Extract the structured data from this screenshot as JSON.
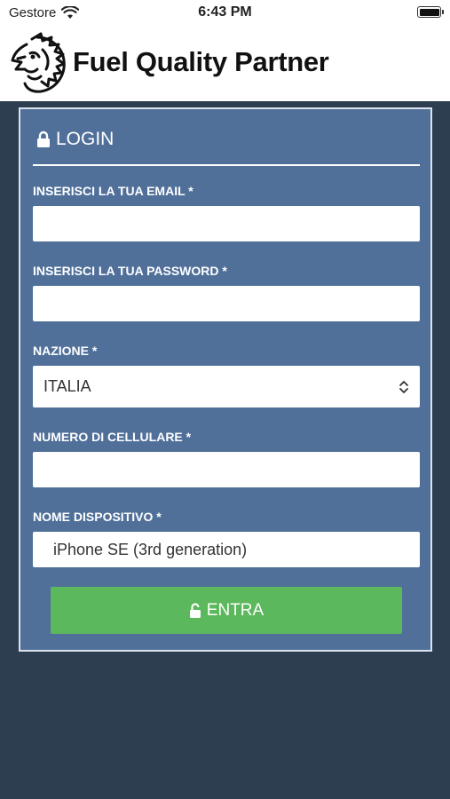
{
  "status_bar": {
    "carrier": "Gestore",
    "time": "6:43 PM"
  },
  "header": {
    "title": "Fuel Quality Partner",
    "logo_icon": "lion-head-logo-icon"
  },
  "login_form": {
    "title": "LOGIN",
    "email": {
      "label": "INSERISCI LA TUA EMAIL *",
      "value": ""
    },
    "password": {
      "label": "INSERISCI LA TUA PASSWORD *",
      "value": ""
    },
    "country": {
      "label": "NAZIONE *",
      "value": "ITALIA"
    },
    "phone": {
      "label": "NUMERO DI CELLULARE *",
      "value": ""
    },
    "device": {
      "label": "NOME DISPOSITIVO *",
      "value": "iPhone SE (3rd generation)"
    },
    "submit_label": "ENTRA"
  },
  "colors": {
    "background": "#2c3e50",
    "card": "#50709a",
    "button": "#5cb85c",
    "header": "#ffffff"
  }
}
